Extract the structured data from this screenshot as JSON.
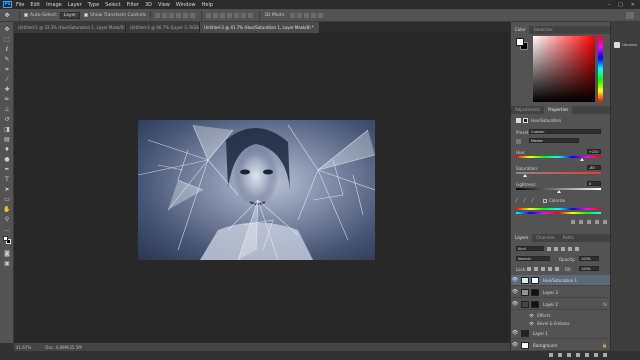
{
  "app": {
    "logo": "Ps"
  },
  "menu": [
    "File",
    "Edit",
    "Image",
    "Layer",
    "Type",
    "Select",
    "Filter",
    "3D",
    "View",
    "Window",
    "Help"
  ],
  "window_controls": {
    "minimize": "–",
    "maximize": "□",
    "close": "✕"
  },
  "options": {
    "auto_select_label": "Auto-Select:",
    "auto_select_value": "Layer",
    "show_transform_label": "Show Transform Controls"
  },
  "tabs": [
    {
      "label": "Untitled-1 @ 33.3% (Hue/Saturation 1, Layer Mask/8) *",
      "close": "×",
      "active": false
    },
    {
      "label": "Untitled-4 @ 66.7% (Layer 2, RGB/8) *",
      "close": "×",
      "active": false
    },
    {
      "label": "Untitled-3 @ 41.7% (Hue/Saturation 1, Layer Mask/8) *",
      "close": "×",
      "active": true
    }
  ],
  "tools": [
    "move-icon",
    "marquee-icon",
    "lasso-icon",
    "quick-select-icon",
    "crop-icon",
    "eyedropper-icon",
    "healing-icon",
    "brush-icon",
    "stamp-icon",
    "history-brush-icon",
    "eraser-icon",
    "gradient-icon",
    "blur-icon",
    "dodge-icon",
    "pen-icon",
    "type-icon",
    "path-select-icon",
    "shape-icon",
    "hand-icon",
    "zoom-icon",
    "more-icon",
    "fg-bg-colors",
    "quick-mask-icon",
    "screen-mode-icon"
  ],
  "status": {
    "zoom": "41.67%",
    "doc": "Doc: 4.89M/35.5M"
  },
  "color_panel": {
    "tabs": [
      "Color",
      "Swatches"
    ],
    "fg_color": "#ffffff",
    "bg_color": "#000000",
    "hue_color": "#ff0000"
  },
  "right_strip": {
    "libraries_label": "Libraries"
  },
  "adjust_panel": {
    "tabs": [
      "Adjustments",
      "Properties"
    ],
    "title": "Hue/Saturation",
    "preset_label": "Preset:",
    "preset_value": "Custom",
    "channel_value": "Master",
    "hue_label": "Hue:",
    "hue_value": "+220",
    "hue_level": 0.78,
    "saturation_label": "Saturation:",
    "saturation_value": "-80",
    "saturation_level": 0.1,
    "lightness_label": "Lightness:",
    "lightness_value": "0",
    "lightness_level": 0.5,
    "colorize_label": "Colorize"
  },
  "layers_panel": {
    "tabs": [
      "Layers",
      "Channels",
      "Paths"
    ],
    "kind_label": "Kind",
    "blend_mode": "Normal",
    "opacity_label": "Opacity:",
    "opacity_value": "100%",
    "lock_label": "Lock:",
    "fill_label": "Fill:",
    "fill_value": "100%",
    "layers": [
      {
        "name": "Hue/Saturation 1",
        "selected": true,
        "fx": ""
      },
      {
        "name": "Layer 3",
        "selected": false,
        "fx": ""
      },
      {
        "name": "Layer 2",
        "selected": false,
        "fx": "fx"
      },
      {
        "name": "Layer 1",
        "selected": false,
        "fx": ""
      },
      {
        "name": "Background",
        "selected": false,
        "fx": "🔒"
      }
    ],
    "effects_label": "Effects",
    "bevel_label": "Bevel & Emboss"
  }
}
